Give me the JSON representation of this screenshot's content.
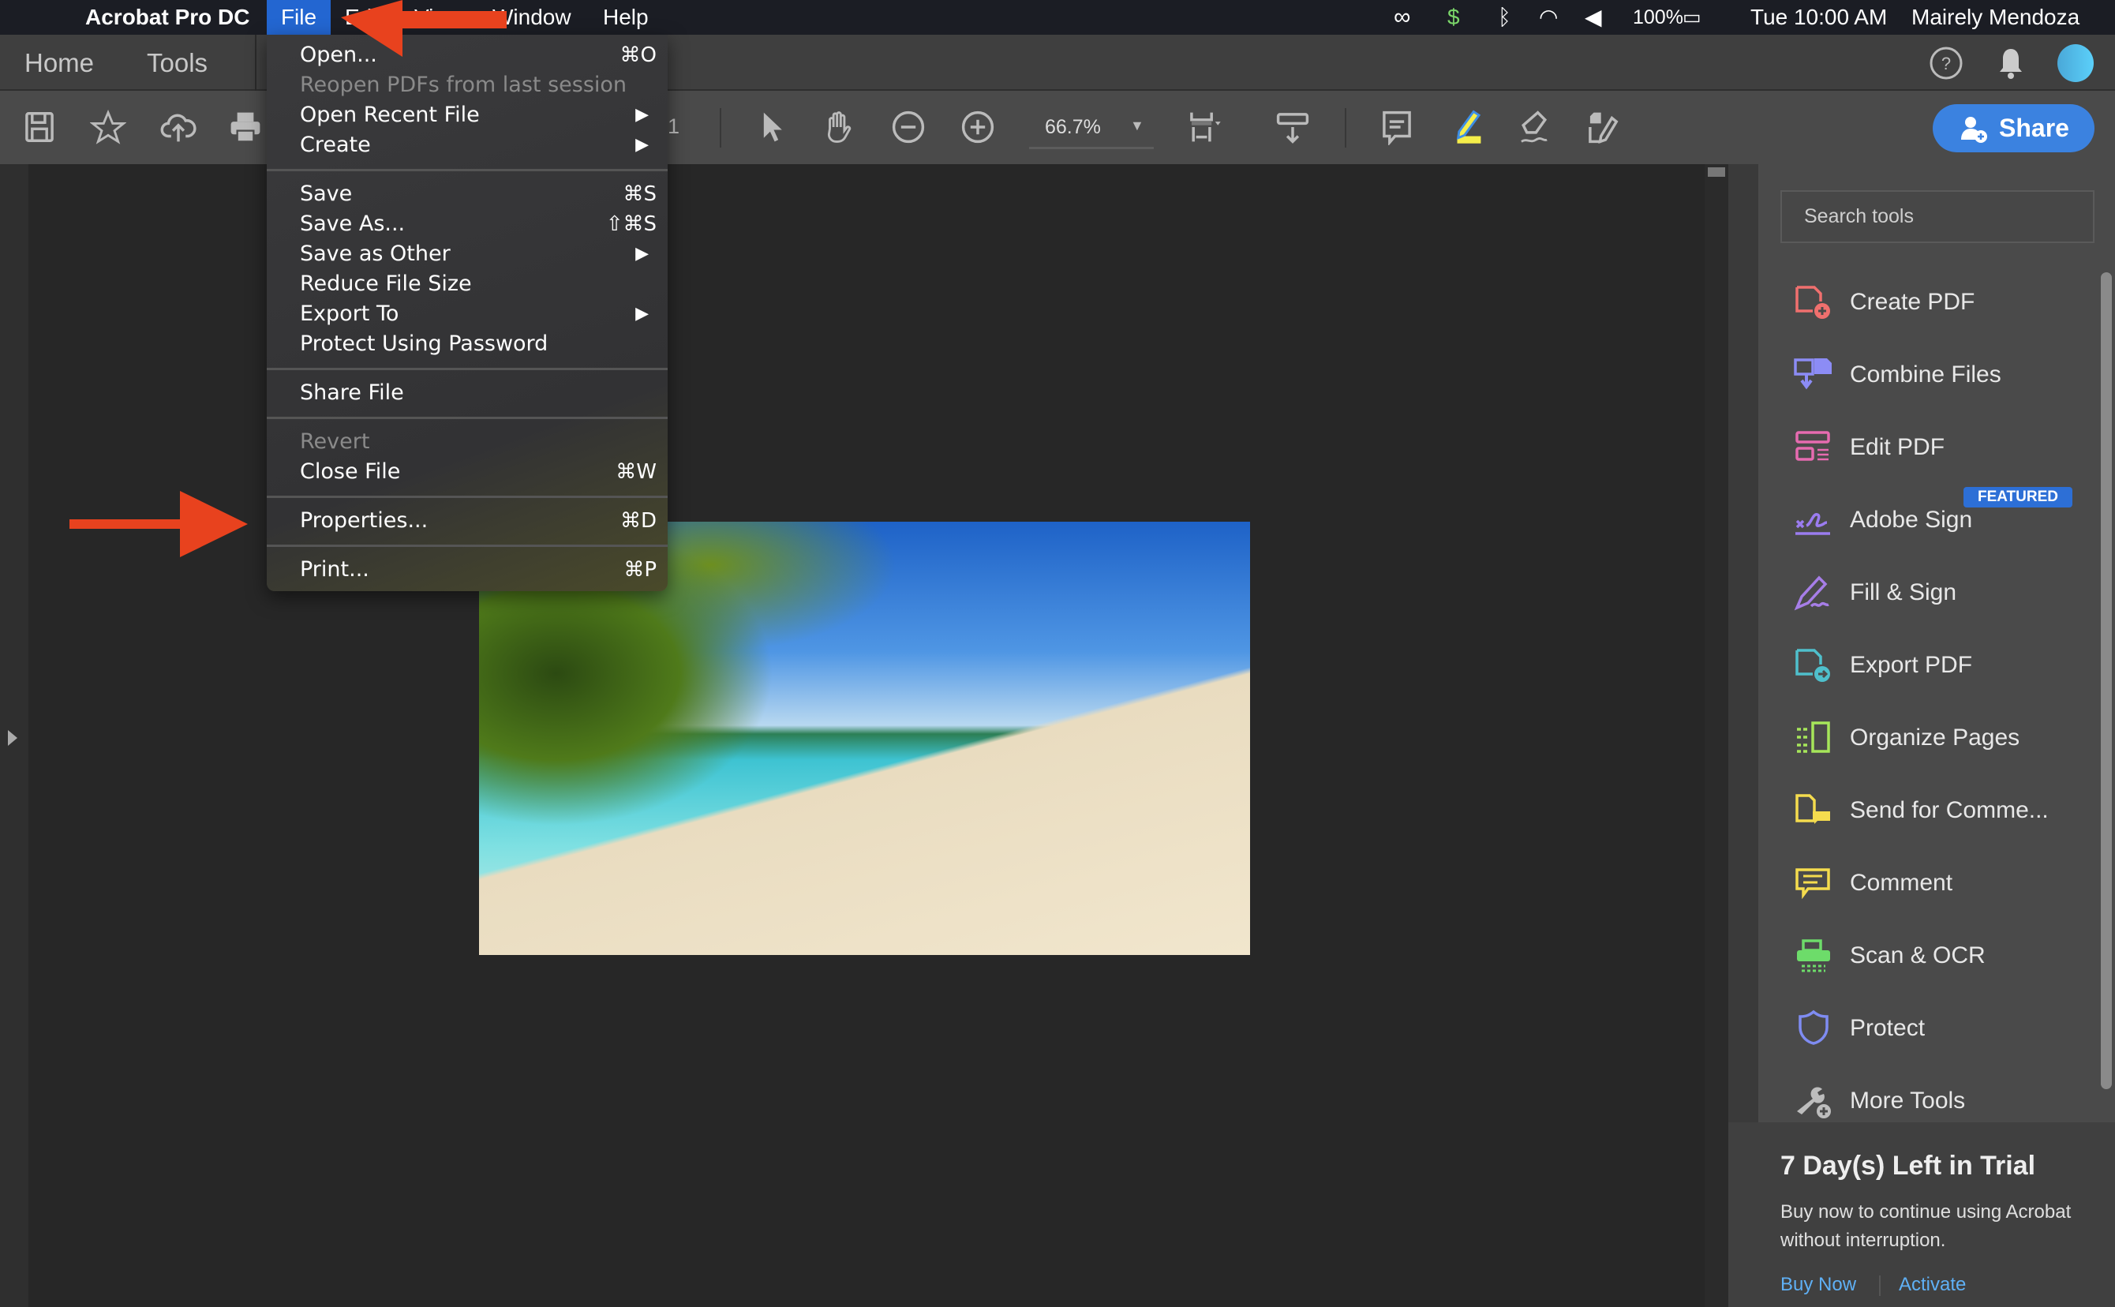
{
  "menubar": {
    "app_name": "Acrobat Pro DC",
    "menus": [
      "File",
      "Edit",
      "View",
      "Window",
      "Help"
    ],
    "battery": "100%",
    "clock": "Tue 10:00 AM",
    "user": "Mairely Mendoza",
    "active_menu": "File"
  },
  "header": {
    "tabs": [
      "Home",
      "Tools"
    ]
  },
  "toolbar": {
    "page_number": "1",
    "zoom": "66.7%",
    "share_label": "Share"
  },
  "file_menu": {
    "group1": [
      {
        "label": "Open...",
        "shortcut": "⌘O"
      },
      {
        "label": "Reopen PDFs from last session",
        "disabled": true
      },
      {
        "label": "Open Recent File",
        "submenu": true
      },
      {
        "label": "Create",
        "submenu": true
      }
    ],
    "group2": [
      {
        "label": "Save",
        "shortcut": "⌘S"
      },
      {
        "label": "Save As...",
        "shortcut": "⇧⌘S"
      },
      {
        "label": "Save as Other",
        "submenu": true
      },
      {
        "label": "Reduce File Size"
      },
      {
        "label": "Export To",
        "submenu": true
      },
      {
        "label": "Protect Using Password"
      }
    ],
    "group3": [
      {
        "label": "Share File"
      }
    ],
    "group4": [
      {
        "label": "Revert",
        "disabled": true
      },
      {
        "label": "Close File",
        "shortcut": "⌘W"
      }
    ],
    "group5": [
      {
        "label": "Properties...",
        "shortcut": "⌘D"
      }
    ],
    "group6": [
      {
        "label": "Print...",
        "shortcut": "⌘P"
      }
    ]
  },
  "right_pane": {
    "search_placeholder": "Search tools",
    "tools": [
      {
        "label": "Create PDF",
        "color": "#f0706e"
      },
      {
        "label": "Combine Files",
        "color": "#8c8cf5"
      },
      {
        "label": "Edit PDF",
        "color": "#e66bb0"
      },
      {
        "label": "Adobe Sign",
        "color": "#9b7cf0"
      },
      {
        "label": "Fill & Sign",
        "color": "#a77ee8"
      },
      {
        "label": "Export PDF",
        "color": "#4fc0cc"
      },
      {
        "label": "Organize Pages",
        "color": "#a6e65a"
      },
      {
        "label": "Send for Comme...",
        "color": "#f5dc4e"
      },
      {
        "label": "Comment",
        "color": "#f5dc4e"
      },
      {
        "label": "Scan & OCR",
        "color": "#6ddc6a"
      },
      {
        "label": "Protect",
        "color": "#7f8cf2"
      },
      {
        "label": "More Tools",
        "color": "#bdbdbd"
      }
    ],
    "featured_badge": "FEATURED",
    "trial": {
      "title": "7 Day(s) Left in Trial",
      "body_line1": "Buy now to continue using Acrobat",
      "body_line2": "without interruption.",
      "buy_now": "Buy Now",
      "activate": "Activate"
    }
  },
  "colors": {
    "accent": "#2d6fd6",
    "annotation_arrow": "#e8421e",
    "menubar": "#1b1d24"
  }
}
